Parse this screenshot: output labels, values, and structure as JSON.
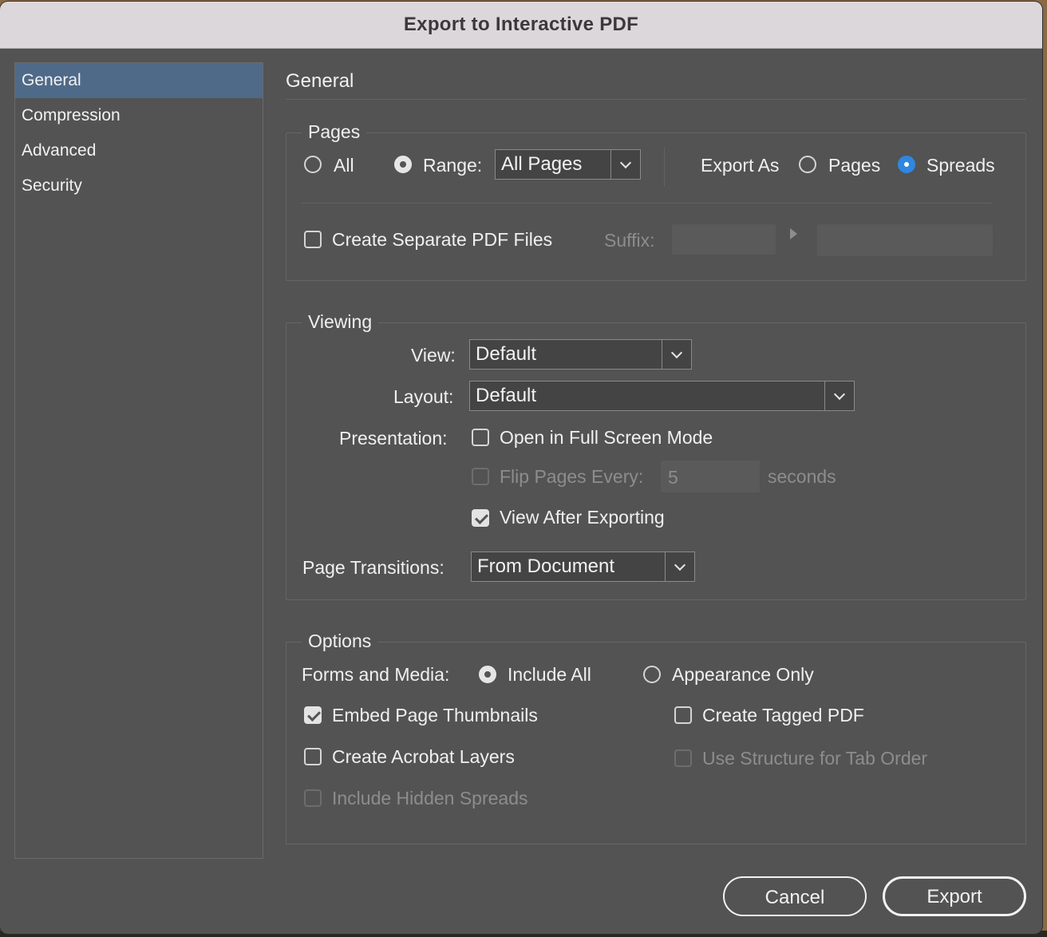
{
  "dialog": {
    "title": "Export to Interactive PDF"
  },
  "sidebar": {
    "items": [
      {
        "label": "General",
        "active": true
      },
      {
        "label": "Compression",
        "active": false
      },
      {
        "label": "Advanced",
        "active": false
      },
      {
        "label": "Security",
        "active": false
      }
    ]
  },
  "section_title": "General",
  "pages": {
    "legend": "Pages",
    "all_label": "All",
    "range_label": "Range:",
    "range_value": "All Pages",
    "export_as_label": "Export As",
    "pages_label": "Pages",
    "spreads_label": "Spreads",
    "selected_scope": "range",
    "export_as_value": "spreads",
    "separate_files_label": "Create Separate PDF Files",
    "separate_files_checked": false,
    "suffix_label": "Suffix:"
  },
  "viewing": {
    "legend": "Viewing",
    "view_label": "View:",
    "view_value": "Default",
    "layout_label": "Layout:",
    "layout_value": "Default",
    "presentation_label": "Presentation:",
    "full_screen_label": "Open in Full Screen Mode",
    "full_screen_checked": false,
    "flip_pages_label": "Flip Pages Every:",
    "flip_pages_value": "5",
    "flip_pages_unit": "seconds",
    "flip_pages_checked": false,
    "view_after_label": "View After Exporting",
    "view_after_checked": true,
    "transitions_label": "Page Transitions:",
    "transitions_value": "From Document"
  },
  "options": {
    "legend": "Options",
    "forms_label": "Forms and Media:",
    "include_all_label": "Include All",
    "appearance_only_label": "Appearance Only",
    "forms_value": "include_all",
    "embed_thumbnails_label": "Embed Page Thumbnails",
    "embed_thumbnails_checked": true,
    "tagged_pdf_label": "Create Tagged PDF",
    "tagged_pdf_checked": false,
    "acrobat_layers_label": "Create Acrobat Layers",
    "acrobat_layers_checked": false,
    "tab_order_label": "Use Structure for Tab Order",
    "tab_order_checked": false,
    "hidden_spreads_label": "Include Hidden Spreads",
    "hidden_spreads_checked": false
  },
  "buttons": {
    "cancel": "Cancel",
    "export": "Export"
  }
}
